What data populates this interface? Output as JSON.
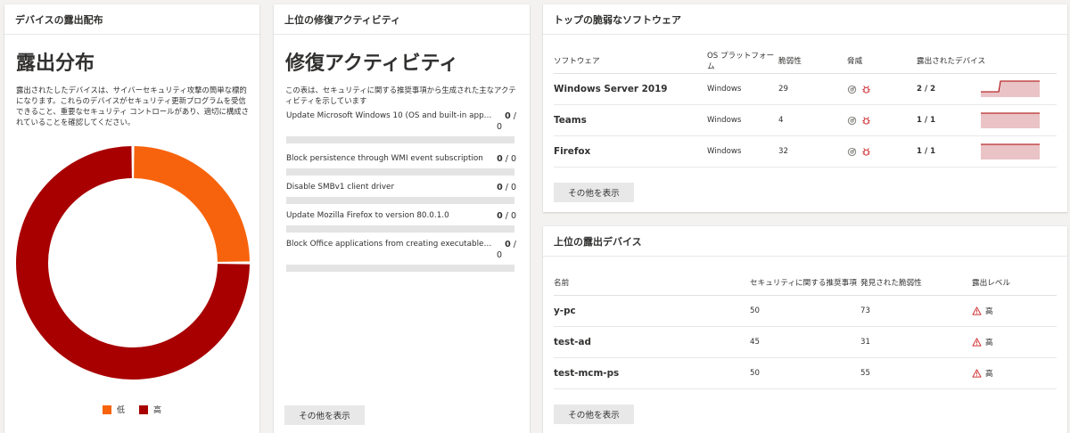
{
  "colors": {
    "low": "#f7630c",
    "high": "#a80000",
    "spark_fill": "#eac3c6",
    "spark_line": "#a80000"
  },
  "exposure": {
    "header": "デバイスの露出配布",
    "title": "露出分布",
    "description": "露出されたしたデバイスは、サイバーセキュリティ攻撃の簡単な標的になります。これらのデバイスがセキュリティ更新プログラムを受信できること、重要なセキュリティ コントロールがあり、適切に構成されていることを確認してください。",
    "legend": [
      {
        "label": "低",
        "color": "#f7630c"
      },
      {
        "label": "高",
        "color": "#a80000"
      }
    ],
    "distribution": {
      "low": 0.25,
      "high": 0.75
    }
  },
  "remediation": {
    "header": "上位の修復アクティビティ",
    "title": "修復アクティビティ",
    "description": "この表は、セキュリティに関する推奨事項から生成された主なアクティビティを示しています",
    "activities": [
      {
        "name": "Update Microsoft Windows 10 (OS and built-in applica...",
        "done": "0",
        "total": "0",
        "progress": 0,
        "wrap": true
      },
      {
        "name": "Block persistence through WMI event subscription",
        "done": "0",
        "total": "0",
        "progress": 0,
        "wrap": false
      },
      {
        "name": "Disable SMBv1 client driver",
        "done": "0",
        "total": "0",
        "progress": 0,
        "wrap": false
      },
      {
        "name": "Update Mozilla Firefox to version 80.0.1.0",
        "done": "0",
        "total": "0",
        "progress": 0,
        "wrap": false
      },
      {
        "name": "Block Office applications from creating executable con...",
        "done": "0",
        "total": "0",
        "progress": 0,
        "wrap": true
      }
    ],
    "show_more": "その他を表示"
  },
  "software": {
    "header": "トップの脆弱なソフトウェア",
    "columns": [
      "ソフトウェア",
      "OS プラットフォーム",
      "脆弱性",
      "脅威",
      "露出されたデバイス"
    ],
    "rows": [
      {
        "name": "Windows Server 2019",
        "platform": "Windows",
        "vulns": "29",
        "devices": "2 / 2",
        "threat_icons": [
          "exploit-icon",
          "bug-icon"
        ]
      },
      {
        "name": "Teams",
        "platform": "Windows",
        "vulns": "4",
        "devices": "1 / 1",
        "threat_icons": [
          "exploit-icon",
          "bug-icon"
        ]
      },
      {
        "name": "Firefox",
        "platform": "Windows",
        "vulns": "32",
        "devices": "1 / 1",
        "threat_icons": [
          "exploit-icon",
          "bug-icon"
        ]
      }
    ],
    "show_more": "その他を表示"
  },
  "devices": {
    "header": "上位の露出デバイス",
    "columns": [
      "名前",
      "セキュリティに関する推奨事項",
      "発見された脆弱性",
      "露出レベル"
    ],
    "rows": [
      {
        "name": "y-pc",
        "recommendations": "50",
        "vulns": "73",
        "level": "高"
      },
      {
        "name": "test-ad",
        "recommendations": "45",
        "vulns": "31",
        "level": "高"
      },
      {
        "name": "test-mcm-ps",
        "recommendations": "50",
        "vulns": "55",
        "level": "高"
      }
    ],
    "show_more": "その他を表示"
  }
}
